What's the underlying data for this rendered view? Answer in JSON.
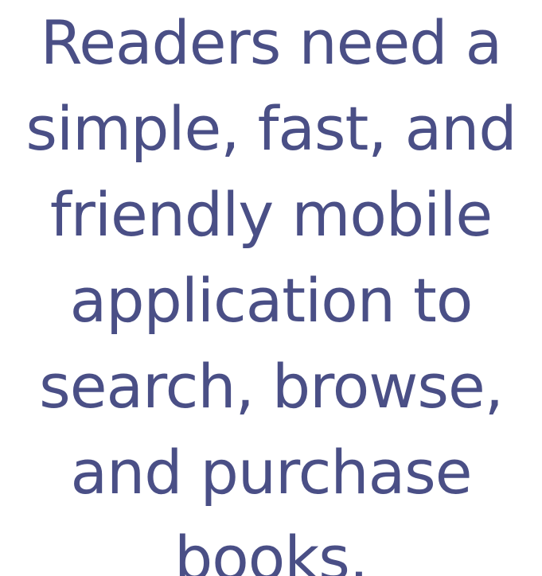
{
  "statement": {
    "lines": [
      "Readers need a",
      "simple, fast, and",
      "friendly mobile",
      "application to",
      "search, browse,",
      "and purchase",
      "books."
    ]
  },
  "colors": {
    "text": "#4a4f86",
    "background": "#ffffff"
  }
}
